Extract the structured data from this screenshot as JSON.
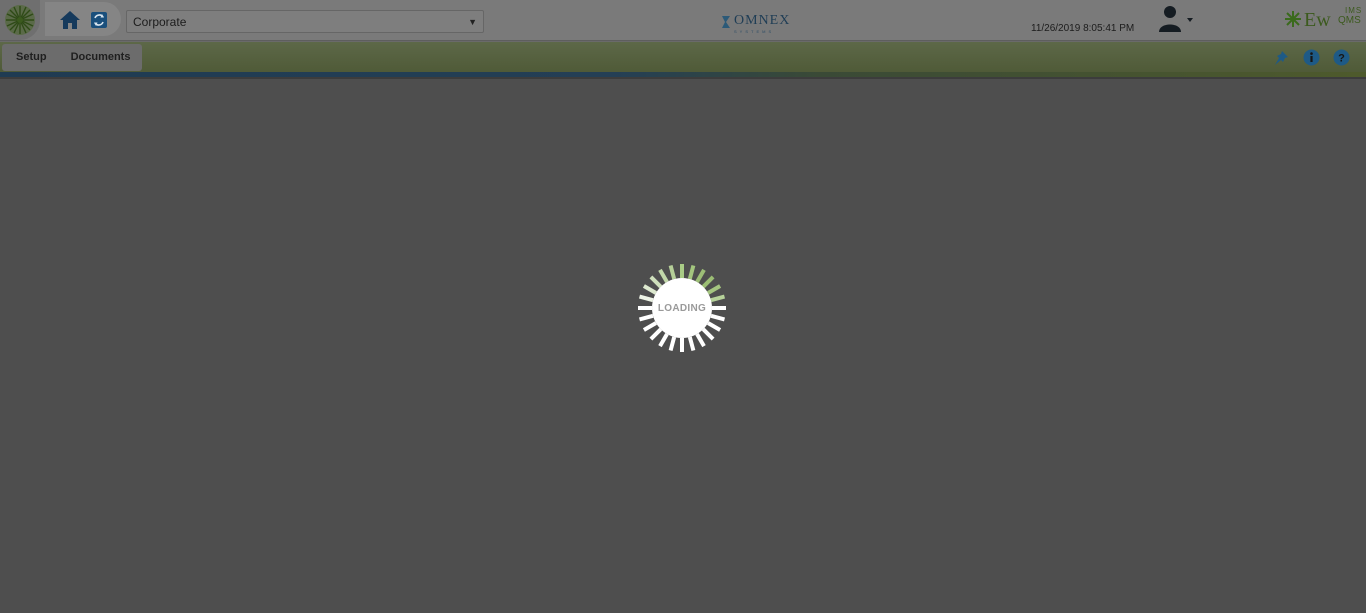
{
  "header": {
    "company_select": {
      "value": "Corporate"
    },
    "brand": {
      "name": "OMNEX",
      "sub": "SYSTEMS"
    },
    "datetime": "11/26/2019 8:05:41 PM",
    "app_logo": {
      "ew": "Ew",
      "ims": "IMS",
      "qms": "QMS"
    }
  },
  "menu": {
    "items": [
      {
        "label": "Setup"
      },
      {
        "label": "Documents"
      }
    ]
  },
  "loader": {
    "text": "LOADING"
  },
  "colors": {
    "accent_green": "#7aa848",
    "overlay": "#4e4e4e",
    "icon_blue": "#1e5a86"
  },
  "icons": [
    "app-logo-icon",
    "home-icon",
    "refresh-icon",
    "user-icon",
    "pin-icon",
    "info-icon",
    "help-icon"
  ]
}
